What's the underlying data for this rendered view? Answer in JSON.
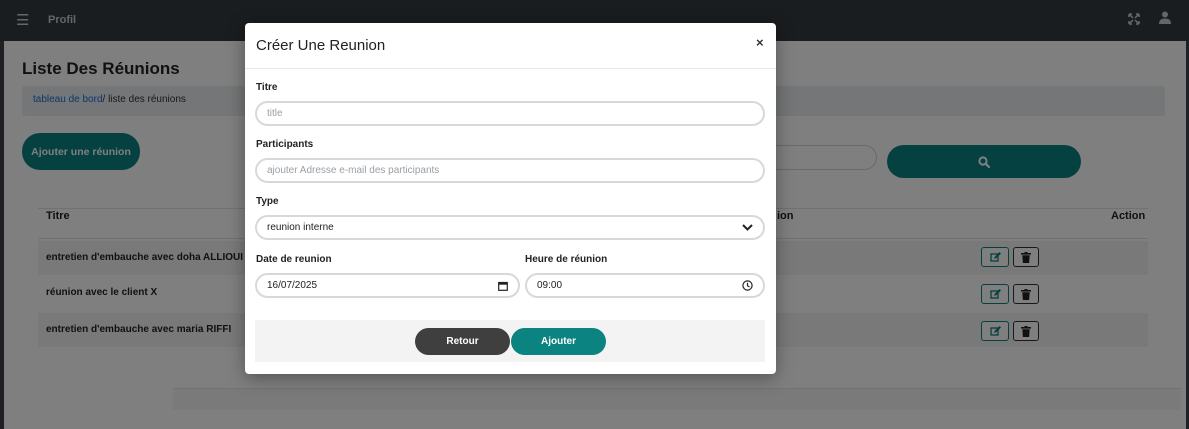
{
  "topbar": {
    "menu_icon": "hamburger-icon",
    "profile_label": "Profil",
    "expand_icon": "fullscreen-icon",
    "user_icon": "user-icon"
  },
  "page": {
    "title": "Liste Des Réunions",
    "breadcrumb": {
      "link": "tableau de bord",
      "current": "/ liste des réunions"
    },
    "add_button": "Ajouter une réunion",
    "search_icon": "search-icon"
  },
  "table": {
    "headers": {
      "title": "Titre",
      "partial": "ion",
      "action": "Action"
    },
    "rows": [
      {
        "title": "entretien d'embauche avec doha ALLIOUI"
      },
      {
        "title": "réunion avec le client X"
      },
      {
        "title": "entretien d'embauche avec maria RIFFI"
      }
    ]
  },
  "modal": {
    "title": "Créer Une Reunion",
    "close": "×",
    "titre_label": "Titre",
    "titre_placeholder": "title",
    "participants_label": "Participants",
    "participants_placeholder": "ajouter Adresse e-mail des participants",
    "type_label": "Type",
    "type_value": "reunion interne",
    "date_label": "Date de reunion",
    "date_value": "16/07/2025",
    "time_label": "Heure de réunion",
    "time_value": "09:00",
    "back_button": "Retour",
    "submit_button": "Ajouter"
  },
  "colors": {
    "accent": "#0b8381",
    "topbar": "#343a40",
    "dark_button": "#3f3f3f"
  }
}
